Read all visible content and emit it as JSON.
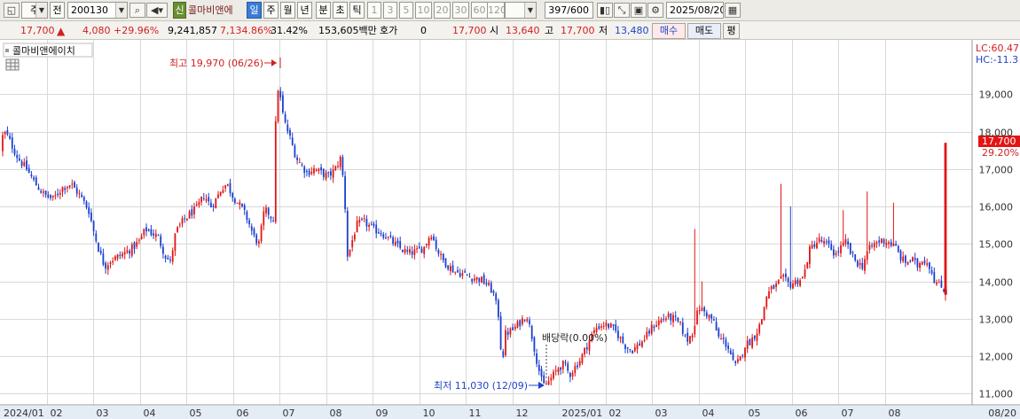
{
  "toolbar": {
    "period": "주",
    "prev_label": "전",
    "code": "200130",
    "shin_label": "신",
    "name": "콜마비앤에",
    "il_label": "일",
    "ju_label": "주",
    "wol_label": "월",
    "nyeon_label": "년",
    "bun_label": "분",
    "cho_label": "초",
    "tick_label": "틱",
    "interval_buttons": [
      "1",
      "3",
      "5",
      "10",
      "20",
      "30",
      "60",
      "120"
    ],
    "count": "397/600",
    "date": "2025/08/20"
  },
  "quote": {
    "price": "17,700",
    "change": "4,080",
    "change_pct": "+29.96%",
    "volume": "9,241,857",
    "volume_pct": "7,134.86%",
    "turnover": "31.42%",
    "amount": "153,605백만",
    "hoga_label": "호가",
    "hoga_value": "0",
    "hoga_price": "17,700",
    "open_label": "시",
    "open": "13,640",
    "high_label": "고",
    "high": "17,700",
    "low_label": "저",
    "low": "13,480",
    "buy_label": "매수",
    "sell_label": "매도",
    "avg_label": "평"
  },
  "chart_data": {
    "type": "candlestick",
    "title": "콜마비앤에이치",
    "ylim": [
      10700,
      20450
    ],
    "yticks": [
      11000,
      12000,
      13000,
      14000,
      15000,
      16000,
      17000,
      18000,
      19000
    ],
    "ytick_labels": [
      "11,000",
      "12,000",
      "13,000",
      "14,000",
      "15,000",
      "16,000",
      "17,000",
      "18,000",
      "19,000"
    ],
    "x_labels": [
      "2024/01",
      "02",
      "03",
      "04",
      "05",
      "06",
      "07",
      "08",
      "09",
      "10",
      "11",
      "12",
      "2025/01",
      "02",
      "03",
      "04",
      "05",
      "06",
      "07",
      "08"
    ],
    "x_label_end": "08/20",
    "path": [
      [
        0,
        17500
      ],
      [
        4,
        18000
      ],
      [
        8,
        17900
      ],
      [
        14,
        17600
      ],
      [
        20,
        17300
      ],
      [
        30,
        17000
      ],
      [
        40,
        16600
      ],
      [
        50,
        16300
      ],
      [
        60,
        16200
      ],
      [
        70,
        16500
      ],
      [
        80,
        16600
      ],
      [
        90,
        16300
      ],
      [
        100,
        15900
      ],
      [
        106,
        15300
      ],
      [
        112,
        14800
      ],
      [
        118,
        14400
      ],
      [
        124,
        14550
      ],
      [
        132,
        14650
      ],
      [
        140,
        14750
      ],
      [
        150,
        14900
      ],
      [
        158,
        15100
      ],
      [
        164,
        15400
      ],
      [
        170,
        15300
      ],
      [
        178,
        15200
      ],
      [
        186,
        14700
      ],
      [
        192,
        14500
      ],
      [
        198,
        15300
      ],
      [
        206,
        15600
      ],
      [
        214,
        15800
      ],
      [
        222,
        15950
      ],
      [
        230,
        16300
      ],
      [
        238,
        16000
      ],
      [
        244,
        16200
      ],
      [
        250,
        16500
      ],
      [
        256,
        16600
      ],
      [
        262,
        16300
      ],
      [
        268,
        16100
      ],
      [
        274,
        15900
      ],
      [
        280,
        15600
      ],
      [
        286,
        15200
      ],
      [
        292,
        15000
      ],
      [
        298,
        15900
      ],
      [
        304,
        15800
      ],
      [
        308,
        15600
      ],
      [
        312,
        19300
      ],
      [
        316,
        18900
      ],
      [
        320,
        18300
      ],
      [
        326,
        17900
      ],
      [
        334,
        17300
      ],
      [
        340,
        17100
      ],
      [
        346,
        16900
      ],
      [
        354,
        17000
      ],
      [
        362,
        16900
      ],
      [
        370,
        16800
      ],
      [
        378,
        17000
      ],
      [
        384,
        17300
      ],
      [
        388,
        16500
      ],
      [
        392,
        14600
      ],
      [
        396,
        15000
      ],
      [
        402,
        15500
      ],
      [
        410,
        15600
      ],
      [
        420,
        15400
      ],
      [
        430,
        15300
      ],
      [
        440,
        15100
      ],
      [
        450,
        14900
      ],
      [
        460,
        14750
      ],
      [
        470,
        14800
      ],
      [
        478,
        14900
      ],
      [
        486,
        15300
      ],
      [
        492,
        14900
      ],
      [
        498,
        14600
      ],
      [
        506,
        14400
      ],
      [
        514,
        14250
      ],
      [
        522,
        14200
      ],
      [
        532,
        14100
      ],
      [
        542,
        14050
      ],
      [
        550,
        13900
      ],
      [
        556,
        13700
      ],
      [
        562,
        13100
      ],
      [
        566,
        11800
      ],
      [
        570,
        12600
      ],
      [
        578,
        12700
      ],
      [
        586,
        12900
      ],
      [
        594,
        13100
      ],
      [
        600,
        12500
      ],
      [
        606,
        11800
      ],
      [
        612,
        11200
      ],
      [
        618,
        11300
      ],
      [
        624,
        11500
      ],
      [
        630,
        11700
      ],
      [
        636,
        11800
      ],
      [
        642,
        11500
      ],
      [
        648,
        11700
      ],
      [
        654,
        11900
      ],
      [
        660,
        12200
      ],
      [
        666,
        12500
      ],
      [
        672,
        12750
      ],
      [
        680,
        12850
      ],
      [
        688,
        12800
      ],
      [
        696,
        12600
      ],
      [
        704,
        12300
      ],
      [
        712,
        12150
      ],
      [
        720,
        12300
      ],
      [
        728,
        12500
      ],
      [
        736,
        12800
      ],
      [
        744,
        12950
      ],
      [
        752,
        13050
      ],
      [
        760,
        13000
      ],
      [
        768,
        12800
      ],
      [
        774,
        12400
      ],
      [
        780,
        12600
      ],
      [
        788,
        13300
      ],
      [
        796,
        13150
      ],
      [
        804,
        12950
      ],
      [
        810,
        12500
      ],
      [
        816,
        12400
      ],
      [
        822,
        12200
      ],
      [
        828,
        11700
      ],
      [
        834,
        11900
      ],
      [
        840,
        12300
      ],
      [
        846,
        12400
      ],
      [
        852,
        12600
      ],
      [
        858,
        12900
      ],
      [
        864,
        13600
      ],
      [
        870,
        13800
      ],
      [
        876,
        13900
      ],
      [
        882,
        14100
      ],
      [
        890,
        13900
      ],
      [
        898,
        14000
      ],
      [
        906,
        14100
      ],
      [
        912,
        14800
      ],
      [
        918,
        15000
      ],
      [
        924,
        15100
      ],
      [
        930,
        15000
      ],
      [
        936,
        14900
      ],
      [
        942,
        14700
      ],
      [
        948,
        14900
      ],
      [
        954,
        15050
      ],
      [
        960,
        14700
      ],
      [
        966,
        14500
      ],
      [
        972,
        14400
      ],
      [
        978,
        14800
      ],
      [
        986,
        15000
      ],
      [
        994,
        15100
      ],
      [
        1002,
        15050
      ],
      [
        1010,
        14900
      ],
      [
        1016,
        14600
      ],
      [
        1022,
        14500
      ],
      [
        1028,
        14600
      ],
      [
        1034,
        14400
      ],
      [
        1040,
        14600
      ],
      [
        1046,
        14500
      ],
      [
        1050,
        14300
      ],
      [
        1054,
        14000
      ],
      [
        1058,
        13900
      ],
      [
        1064,
        13800
      ],
      [
        1066,
        13700
      ]
    ],
    "spikes": [
      [
        780,
        15400
      ],
      [
        788,
        14000
      ],
      [
        878,
        16600
      ],
      [
        888,
        16000
      ],
      [
        948,
        15900
      ],
      [
        976,
        16400
      ],
      [
        1004,
        16100
      ]
    ],
    "last_candle": {
      "open": 13640,
      "high": 17700,
      "low": 13480,
      "close": 17700
    },
    "annotations": {
      "high_label": "최고 19,970 (06/26)",
      "low_label": "최저 11,030 (12/09)",
      "dividend_label": "배당락(0.00%)",
      "lc": "LC:60.47",
      "hc": "HC:-11.3",
      "last_price": "17,700",
      "last_pct": "29.20%"
    },
    "colors": {
      "up": "#e31414",
      "down": "#1b3fd0",
      "grid": "#d9d9d9"
    }
  }
}
